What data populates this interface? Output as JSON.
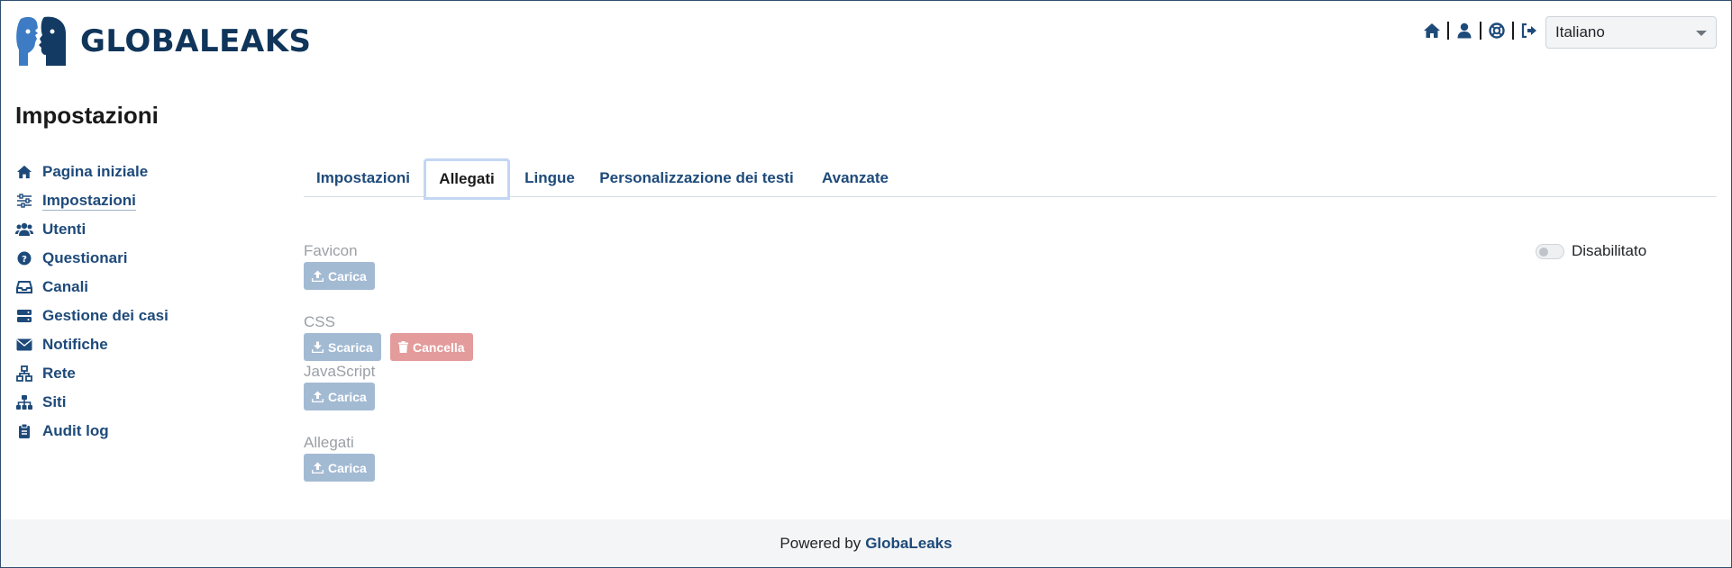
{
  "app": {
    "logo_text": "GLOBALEAKS",
    "accent": "#1e4a7a",
    "logo_blue": "#3d7cc4"
  },
  "header": {
    "icons": [
      "home-icon",
      "user-icon",
      "lifebuoy-icon",
      "logout-icon"
    ],
    "language": {
      "selected": "Italiano"
    }
  },
  "page": {
    "title": "Impostazioni"
  },
  "sidebar": {
    "items": [
      {
        "label": "Pagina iniziale",
        "icon": "home-icon"
      },
      {
        "label": "Impostazioni",
        "icon": "sliders-icon",
        "active": true
      },
      {
        "label": "Utenti",
        "icon": "users-icon"
      },
      {
        "label": "Questionari",
        "icon": "question-circle-icon"
      },
      {
        "label": "Canali",
        "icon": "inbox-icon"
      },
      {
        "label": "Gestione dei casi",
        "icon": "server-icon"
      },
      {
        "label": "Notifiche",
        "icon": "envelope-icon"
      },
      {
        "label": "Rete",
        "icon": "network-icon"
      },
      {
        "label": "Siti",
        "icon": "sitemap-icon"
      },
      {
        "label": "Audit log",
        "icon": "clipboard-icon"
      }
    ]
  },
  "tabs": [
    {
      "label": "Impostazioni"
    },
    {
      "label": "Allegati",
      "active": true
    },
    {
      "label": "Lingue"
    },
    {
      "label": "Personalizzazione dei testi"
    },
    {
      "label": "Avanzate"
    }
  ],
  "content": {
    "favicon": {
      "label": "Favicon",
      "upload": "Carica"
    },
    "css": {
      "label": "CSS",
      "download": "Scarica",
      "delete": "Cancella"
    },
    "javascript": {
      "label": "JavaScript",
      "upload": "Carica"
    },
    "attachments": {
      "label": "Allegati",
      "upload": "Carica"
    },
    "toggle": {
      "label": "Disabilitato",
      "enabled": false
    }
  },
  "footer": {
    "prefix": "Powered by",
    "brand": "GlobaLeaks"
  }
}
